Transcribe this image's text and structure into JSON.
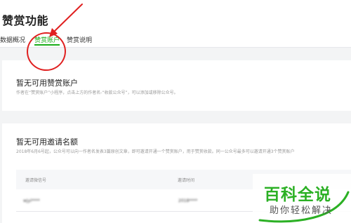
{
  "header": {
    "title": "赞赏功能",
    "tabs": [
      {
        "label": "数据概况"
      },
      {
        "label": "赞赏账户"
      },
      {
        "label": "赞赏说明"
      }
    ],
    "active_tab": "赞赏账户"
  },
  "account_card": {
    "title": "暂无可用赞赏账户",
    "description": "作者在“赞赏账户”小程序，点击上方的作者名-“收款公众号”，可以添加或移除公众号。"
  },
  "invite_card": {
    "title": "暂无可用邀请名额",
    "description": "2018年6月6号起，公众号可以向一作者名发表3篇原创文章，即可邀请开通一个赞赏账户，用于赞赏收款。同一公众号最多可以邀请开通3个赞赏账户",
    "table": {
      "columns": [
        "邀请微信号",
        "邀请时间"
      ],
      "rows": [
        {
          "wechat_id": "wjyi****",
          "time": "2018****"
        }
      ]
    }
  },
  "watermark": {
    "title": "百科全说",
    "subtitle": "助你轻松解决"
  },
  "colors": {
    "accent": "#1aad19",
    "annotation": "#e02020",
    "watermark": "#2bb024"
  }
}
